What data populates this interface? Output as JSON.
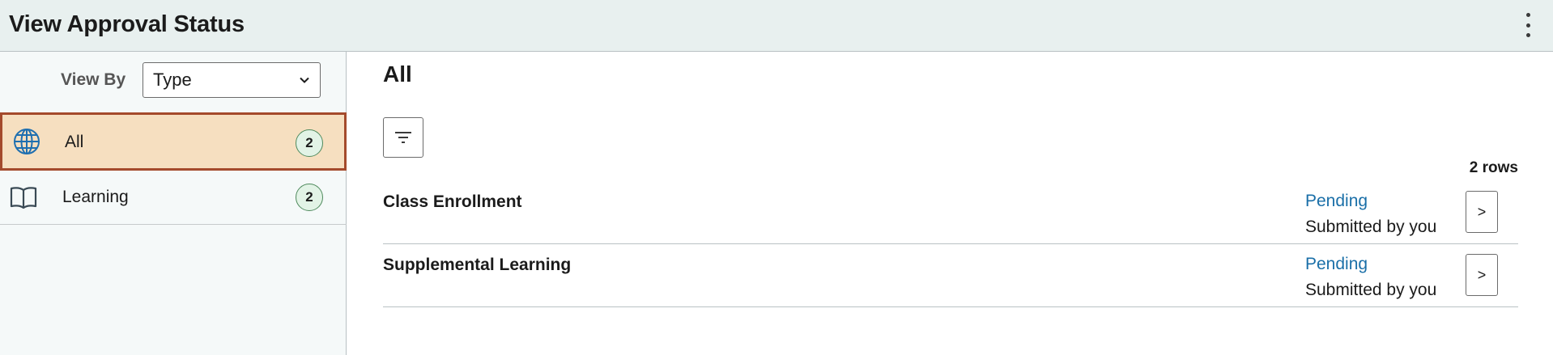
{
  "header": {
    "title": "View Approval Status",
    "menu_icon": "kebab-menu-icon"
  },
  "sidebar": {
    "view_by_label": "View By",
    "view_by_value": "Type",
    "items": [
      {
        "label": "All",
        "count": "2",
        "icon": "globe-icon",
        "selected": true
      },
      {
        "label": "Learning",
        "count": "2",
        "icon": "book-icon",
        "selected": false
      }
    ]
  },
  "main": {
    "title": "All",
    "filter_icon": "filter-icon",
    "row_count": "2 rows",
    "rows": [
      {
        "title": "Class Enrollment",
        "status": "Pending",
        "submitted": "Submitted by you",
        "action": ">"
      },
      {
        "title": "Supplemental Learning",
        "status": "Pending",
        "submitted": "Submitted by you",
        "action": ">"
      }
    ]
  },
  "colors": {
    "header_bg": "#e8f0ef",
    "selected_bg": "#f6dfc0",
    "selected_border": "#a44a2c",
    "status_link": "#1a6fa8",
    "badge_bg": "#e2f3e6"
  }
}
